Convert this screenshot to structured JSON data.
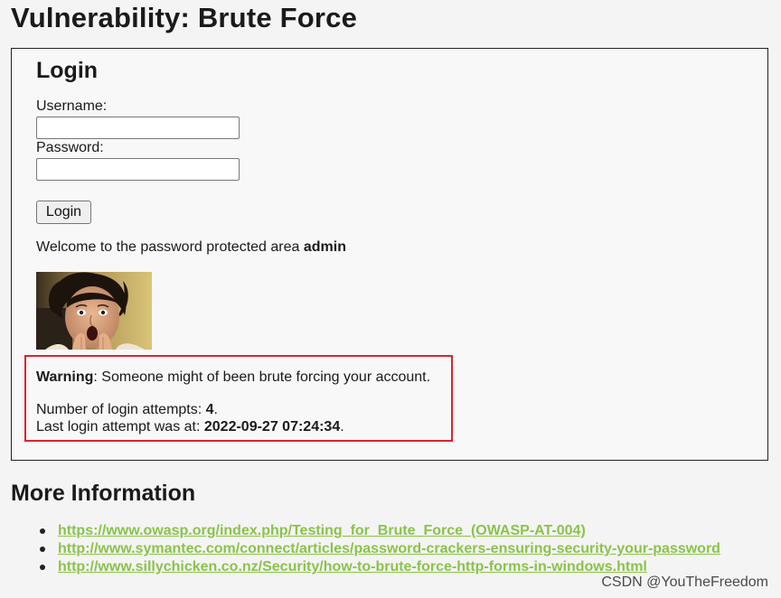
{
  "page": {
    "title": "Vulnerability: Brute Force"
  },
  "login": {
    "heading": "Login",
    "username_label": "Username:",
    "username_value": "",
    "password_label": "Password:",
    "password_value": "",
    "button_label": "Login"
  },
  "result": {
    "welcome_text": "Welcome to the password protected area ",
    "username": "admin",
    "warning_label": "Warning",
    "warning_text": ": Someone might of been brute forcing your account.",
    "attempts_label": "Number of login attempts: ",
    "attempts_count": "4",
    "attempts_suffix": ".",
    "last_attempt_label": "Last login attempt was at: ",
    "last_attempt_time": "2022-09-27 07:24:34",
    "last_attempt_suffix": ".",
    "highlight_color": "#d9252f"
  },
  "more_info": {
    "heading": "More Information",
    "links": [
      {
        "text": "https://www.owasp.org/index.php/Testing_for_Brute_Force_(OWASP-AT-004)"
      },
      {
        "text": "http://www.symantec.com/connect/articles/password-crackers-ensuring-security-your-password"
      },
      {
        "text": "http://www.sillychicken.co.nz/Security/how-to-brute-force-http-forms-in-windows.html"
      }
    ],
    "link_color": "#8bc34a"
  },
  "watermark": "CSDN @YouTheFreedom"
}
